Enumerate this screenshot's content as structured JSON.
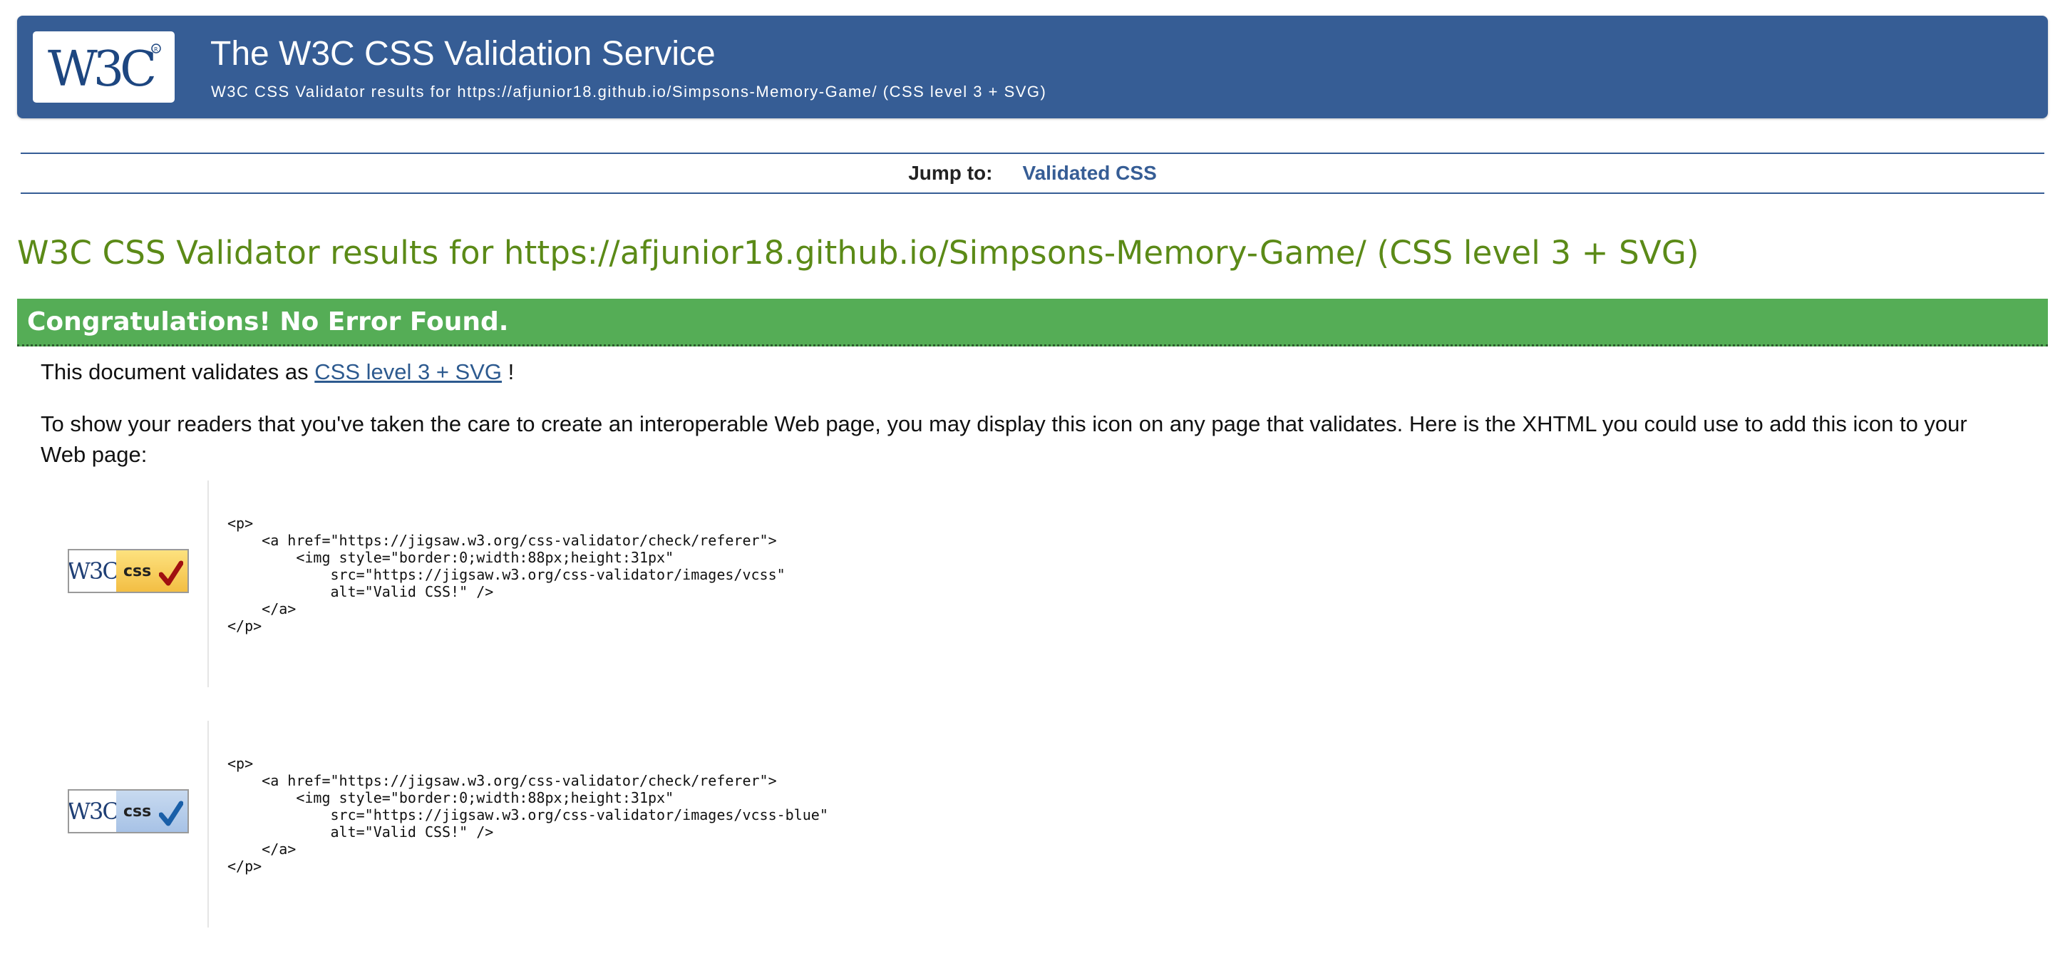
{
  "banner": {
    "logo_text": "W3C",
    "title": "The W3C CSS Validation Service",
    "subtitle": "W3C CSS Validator results for https://afjunior18.github.io/Simpsons-Memory-Game/ (CSS level 3 + SVG)"
  },
  "jump": {
    "label": "Jump to:",
    "link": "Validated CSS"
  },
  "results_heading": "W3C CSS Validator results for https://afjunior18.github.io/Simpsons-Memory-Game/ (CSS level 3 + SVG)",
  "congrats": "Congratulations! No Error Found.",
  "validates": {
    "prefix": "This document validates as",
    "link": "CSS level 3 + SVG",
    "suffix": "!"
  },
  "show_text": "To show your readers that you've taken the care to create an interoperable Web page, you may display this icon on any page that validates. Here is the XHTML you could use to add this icon to your Web page:",
  "snippets": [
    {
      "badge": {
        "w3c": "W3C",
        "css": "css",
        "check_color": "#a01010"
      },
      "code": "<p>\n    <a href=\"https://jigsaw.w3.org/css-validator/check/referer\">\n        <img style=\"border:0;width:88px;height:31px\"\n            src=\"https://jigsaw.w3.org/css-validator/images/vcss\"\n            alt=\"Valid CSS!\" />\n    </a>\n</p>"
    },
    {
      "badge": {
        "w3c": "W3C",
        "css": "css",
        "check_color": "#1a5fa8"
      },
      "code": "<p>\n    <a href=\"https://jigsaw.w3.org/css-validator/check/referer\">\n        <img style=\"border:0;width:88px;height:31px\"\n            src=\"https://jigsaw.w3.org/css-validator/images/vcss-blue\"\n            alt=\"Valid CSS!\" />\n    </a>\n</p>"
    }
  ],
  "colors": {
    "banner_bg": "#365d95",
    "heading_green": "#5b8a17",
    "congrats_green": "#55ad56",
    "link_blue": "#2d5a8f"
  }
}
